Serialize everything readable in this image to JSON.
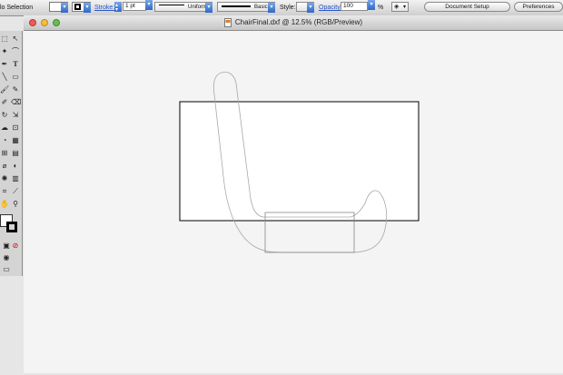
{
  "control_bar": {
    "selection_label": "lo Selection",
    "stroke_label": "Stroke:",
    "stroke_weight": "1 pt",
    "profile_label": "Uniform",
    "brush_label": "Basic",
    "style_label": "Style:",
    "opacity_label": "Opacity:",
    "opacity_value": "100",
    "opacity_unit": "%",
    "document_setup_label": "Document Setup",
    "preferences_label": "Preferences"
  },
  "document": {
    "title": "ChairFinal.dxf @ 12.5% (RGB/Preview)"
  },
  "colors": {
    "accent": "#2a55c9",
    "canvas_bg": "#f4f4f4",
    "artboard_stroke": "#000000",
    "chair_outline": "#a8a8a8"
  },
  "tools": [
    "selection-tool",
    "direct-selection-tool",
    "magic-wand-tool",
    "lasso-tool",
    "pen-tool",
    "type-tool",
    "line-segment-tool",
    "rectangle-tool",
    "paintbrush-tool",
    "pencil-tool",
    "blob-brush-tool",
    "eraser-tool",
    "rotate-tool",
    "scale-tool",
    "warp-tool",
    "free-transform-tool",
    "shape-builder-tool",
    "perspective-grid-tool",
    "mesh-tool",
    "gradient-tool",
    "eyedropper-tool",
    "blend-tool",
    "symbol-sprayer-tool",
    "column-graph-tool",
    "artboard-tool",
    "slice-tool",
    "hand-tool",
    "zoom-tool",
    "fill-stroke-swatch",
    "color-mode-buttons",
    "screen-mode-button"
  ]
}
